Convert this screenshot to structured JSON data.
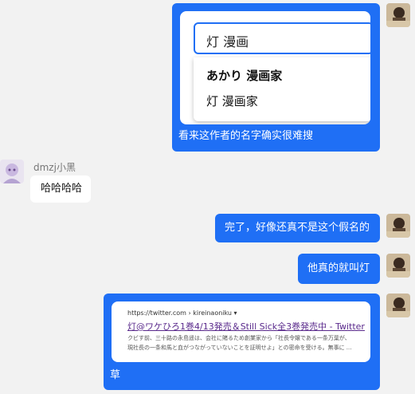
{
  "messages": [
    {
      "id": "m1",
      "side": "right",
      "search_preview": {
        "query": "灯 漫画",
        "suggestions": [
          "あかり 漫画家",
          "灯 漫画家"
        ]
      },
      "text": "看来这作者的名字确实很难搜"
    },
    {
      "id": "m2",
      "side": "left",
      "sender": "dmzj小黑",
      "text": "哈哈哈哈"
    },
    {
      "id": "m3",
      "side": "right",
      "text": "完了，好像还真不是这个假名的"
    },
    {
      "id": "m4",
      "side": "right",
      "text": "他真的就叫灯"
    },
    {
      "id": "m5",
      "side": "right",
      "link_preview": {
        "url": "https://twitter.com › kireinaoniku ▾",
        "title": "灯@ワケひろ1巻4/13発売＆Still Sick全3巻発売中 - Twitter",
        "snippet_line1": "クビす前、三十路の永島遥は、会社に賭るため創業家から「社長令嬢である一条万葉が、",
        "snippet_line2": "現社長の一条和馬と血がつながっていないことを証明せよ」との密命を受ける。無事に ..."
      },
      "text": "草"
    }
  ],
  "colors": {
    "background": "#f2f2f2",
    "own_bubble": "#1f6ff5",
    "other_bubble": "#ffffff",
    "link_title": "#5a2a8c",
    "search_border": "#1f6ff5"
  }
}
